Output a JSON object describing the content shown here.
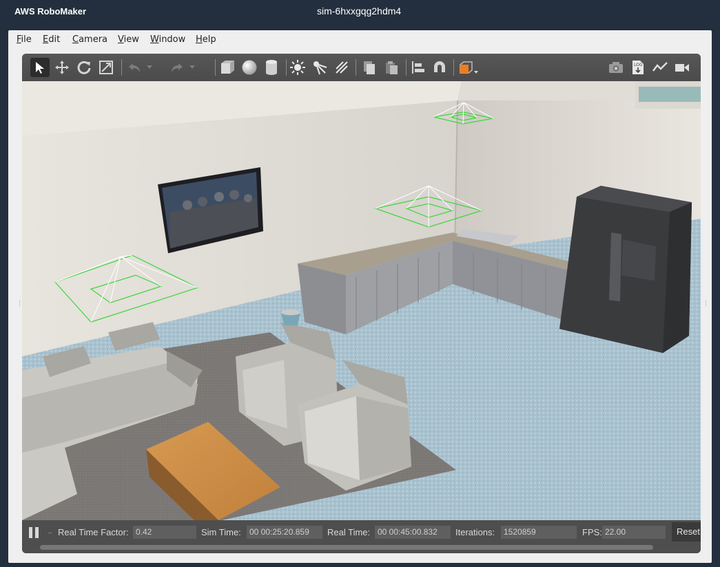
{
  "titlebar": {
    "app": "AWS RoboMaker",
    "sim": "sim-6hxxgqg2hdm4"
  },
  "menu": [
    {
      "label": "File",
      "key": "F",
      "rest": "ile"
    },
    {
      "label": "Edit",
      "key": "E",
      "rest": "dit"
    },
    {
      "label": "Camera",
      "key": "C",
      "rest": "amera"
    },
    {
      "label": "View",
      "key": "V",
      "rest": "iew"
    },
    {
      "label": "Window",
      "key": "W",
      "rest": "indow"
    },
    {
      "label": "Help",
      "key": "H",
      "rest": "elp"
    }
  ],
  "toolbar": {
    "tools": [
      "select-arrow-icon",
      "translate-icon",
      "rotate-icon",
      "scale-icon",
      "undo-icon",
      "redo-icon",
      "box-icon",
      "sphere-icon",
      "cylinder-icon",
      "point-light-icon",
      "spot-light-icon",
      "directional-light-icon",
      "copy-icon",
      "paste-icon",
      "align-icon",
      "magnet-icon",
      "view-angle-icon"
    ],
    "right_tools": [
      "screenshot-icon",
      "log-icon",
      "plot-icon",
      "record-video-icon"
    ]
  },
  "status": {
    "ellipsis": "..",
    "rtf_label": "Real Time Factor:",
    "rtf_value": "0.42",
    "sim_time_label": "Sim Time:",
    "sim_time_value": "00 00:25:20.859",
    "real_time_label": "Real Time:",
    "real_time_value": "00 00:45:00.832",
    "iterations_label": "Iterations:",
    "iterations_value": "1520859",
    "fps_label": "FPS:",
    "fps_value": "22.00",
    "reset_label": "Reset"
  },
  "colors": {
    "titlebar": "#232f3e",
    "toolbar": "#505050",
    "light_gizmo": "#3bd63b",
    "floor": "#a9c4d2"
  }
}
